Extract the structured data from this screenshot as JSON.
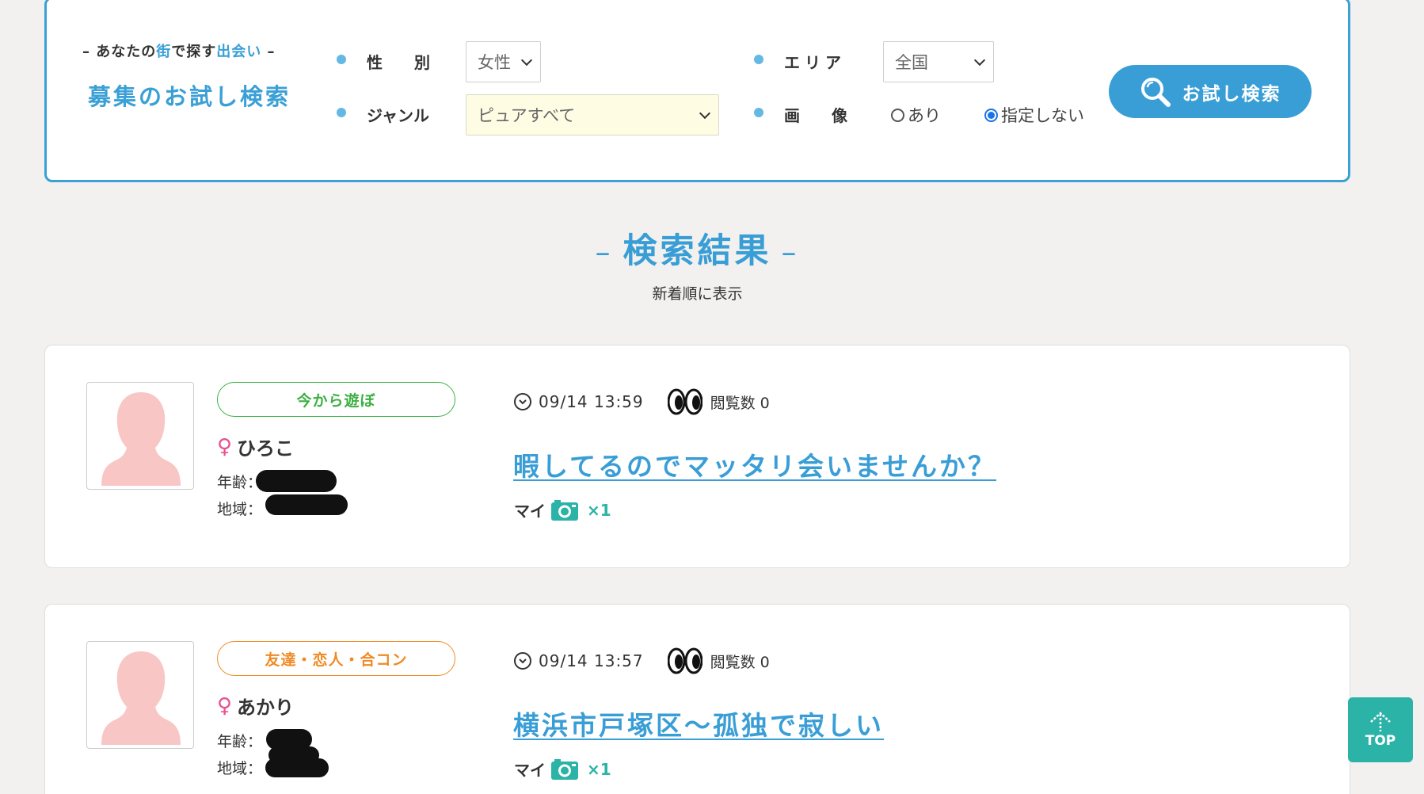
{
  "search": {
    "catch_parts": [
      "– あなたの",
      "街",
      "で探す",
      "出会い",
      " –"
    ],
    "title": "募集のお試し検索",
    "gender_label": "性　　別",
    "gender_value": "女性",
    "genre_label": "ジャンル",
    "genre_value": "ピュアすべて",
    "area_label": "エリア",
    "area_value": "全国",
    "image_label": "画　　像",
    "image_options": [
      "あり",
      "指定しない"
    ],
    "image_selected": "指定しない",
    "button_label": "お試し検索"
  },
  "results": {
    "heading": "検索結果",
    "dash_left": "–",
    "dash_right": "–",
    "sort_note": "新着順に表示"
  },
  "posts": [
    {
      "genre": "今から遊ぼ",
      "genre_color": "#3cb043",
      "name": "ひろこ",
      "gender_symbol": "♀",
      "age_label": "年齢：",
      "area_label": "地域：",
      "datetime": "09/14 13:59",
      "views_label": "閲覧数 0",
      "title": "暇してるのでマッタリ会いませんか？",
      "photo_owner": "マイ",
      "photo_count": "×1"
    },
    {
      "genre": "友達・恋人・合コン",
      "genre_color": "#f08a24",
      "name": "あかり",
      "gender_symbol": "♀",
      "age_label": "年齢：",
      "area_label": "地域：",
      "datetime": "09/14 13:57",
      "views_label": "閲覧数 0",
      "title": "横浜市戸塚区～孤独で寂しい",
      "photo_owner": "マイ",
      "photo_count": "×1"
    }
  ],
  "top_button": {
    "label": "TOP"
  },
  "colors": {
    "accent": "#3a9ed6",
    "panel_border": "#3aa0d6",
    "teal": "#2bb3a8",
    "female": "#e8508f",
    "avatar_silhouette": "#f9c6c6"
  }
}
